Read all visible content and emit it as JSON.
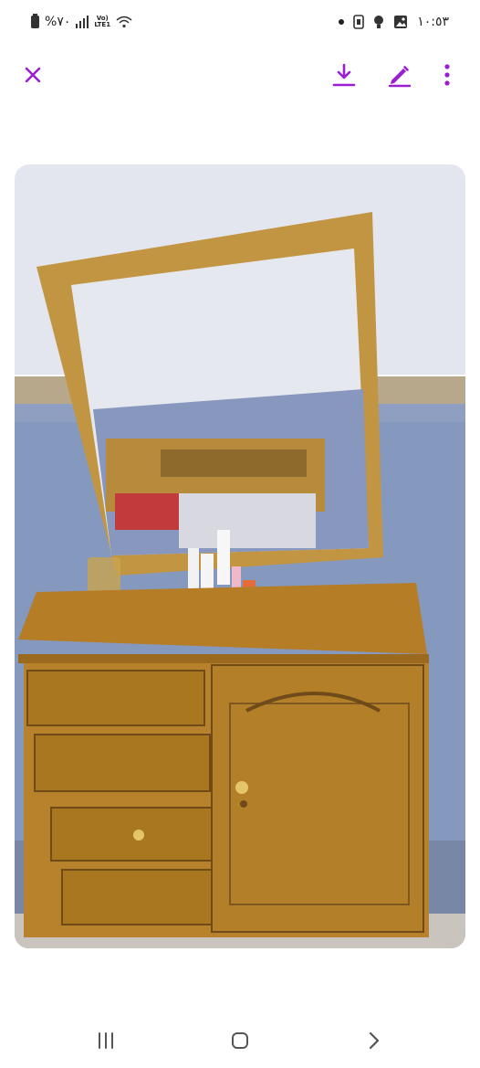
{
  "status_bar": {
    "battery_text": "%٧٠",
    "network_label_top": "Vo)",
    "network_label_bottom": "LTE1",
    "time": "١٠:٥٣",
    "icons": [
      "battery-icon",
      "signal-icon",
      "wifi-icon",
      "dot-icon",
      "phone-icon",
      "bulb-icon",
      "gallery-icon"
    ]
  },
  "toolbar": {
    "icons": [
      "close-icon",
      "download-icon",
      "edit-icon",
      "more-icon"
    ],
    "accent_color": "#9a1fd1"
  },
  "image": {
    "subject": "dresser-with-mirror-photo"
  },
  "navigation_bar": {
    "icons": [
      "recent-apps-icon",
      "home-icon",
      "back-icon"
    ]
  }
}
